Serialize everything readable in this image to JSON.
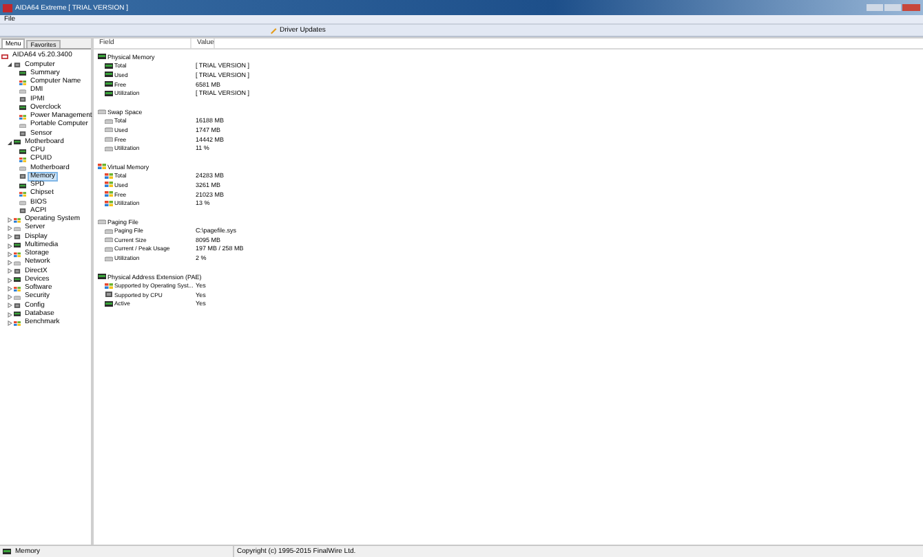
{
  "window": {
    "title": "AIDA64 Extreme [ TRIAL VERSION ]"
  },
  "menu": [
    "File"
  ],
  "toolbar": [
    {
      "label": "Driver Updates"
    }
  ],
  "tabs": [
    {
      "label": "Menu",
      "selected": true
    },
    {
      "label": "Favorites",
      "selected": false
    }
  ],
  "tree": {
    "label": "AIDA64 v5.20.3400",
    "children": [
      {
        "label": "Computer",
        "expanded": true,
        "selected": false,
        "children": [
          {
            "label": "Summary",
            "selected": false
          },
          {
            "label": "Computer Name",
            "selected": false
          },
          {
            "label": "DMI",
            "selected": false
          },
          {
            "label": "IPMI",
            "selected": false
          },
          {
            "label": "Overclock",
            "selected": false
          },
          {
            "label": "Power Management",
            "selected": false
          },
          {
            "label": "Portable Computer",
            "selected": false
          },
          {
            "label": "Sensor",
            "selected": false
          }
        ]
      },
      {
        "label": "Motherboard",
        "expanded": true,
        "selected": false,
        "children": [
          {
            "label": "CPU",
            "selected": false
          },
          {
            "label": "CPUID",
            "selected": false
          },
          {
            "label": "Motherboard",
            "selected": false
          },
          {
            "label": "Memory",
            "selected": true
          },
          {
            "label": "SPD",
            "selected": false
          },
          {
            "label": "Chipset",
            "selected": false
          },
          {
            "label": "BIOS",
            "selected": false
          },
          {
            "label": "ACPI",
            "selected": false
          }
        ]
      },
      {
        "label": "Operating System",
        "expanded": false,
        "selected": false
      },
      {
        "label": "Server",
        "expanded": false,
        "selected": false
      },
      {
        "label": "Display",
        "expanded": false,
        "selected": false
      },
      {
        "label": "Multimedia",
        "expanded": false,
        "selected": false
      },
      {
        "label": "Storage",
        "expanded": false,
        "selected": false
      },
      {
        "label": "Network",
        "expanded": false,
        "selected": false
      },
      {
        "label": "DirectX",
        "expanded": false,
        "selected": false
      },
      {
        "label": "Devices",
        "expanded": false,
        "selected": false
      },
      {
        "label": "Software",
        "expanded": false,
        "selected": false
      },
      {
        "label": "Security",
        "expanded": false,
        "selected": false
      },
      {
        "label": "Config",
        "expanded": false,
        "selected": false
      },
      {
        "label": "Database",
        "expanded": false,
        "selected": false
      },
      {
        "label": "Benchmark",
        "expanded": false,
        "selected": false
      }
    ]
  },
  "table": {
    "columns": [
      "Field",
      "Value"
    ],
    "groups": [
      {
        "title": "Physical Memory",
        "rows": [
          [
            "Total",
            "[ TRIAL VERSION ]"
          ],
          [
            "Used",
            "[ TRIAL VERSION ]"
          ],
          [
            "Free",
            "6581 MB"
          ],
          [
            "Utilization",
            "[ TRIAL VERSION ]"
          ]
        ]
      },
      {
        "title": "Swap Space",
        "rows": [
          [
            "Total",
            "16188 MB"
          ],
          [
            "Used",
            "1747 MB"
          ],
          [
            "Free",
            "14442 MB"
          ],
          [
            "Utilization",
            "11 %"
          ]
        ]
      },
      {
        "title": "Virtual Memory",
        "rows": [
          [
            "Total",
            "24283 MB"
          ],
          [
            "Used",
            "3261 MB"
          ],
          [
            "Free",
            "21023 MB"
          ],
          [
            "Utilization",
            "13 %"
          ]
        ]
      },
      {
        "title": "Paging File",
        "rows": [
          [
            "Paging File",
            "C:\\pagefile.sys"
          ],
          [
            "Current Size",
            "8095 MB"
          ],
          [
            "Current / Peak Usage",
            "197 MB / 258 MB"
          ],
          [
            "Utilization",
            "2 %"
          ]
        ]
      },
      {
        "title": "Physical Address Extension (PAE)",
        "rows": [
          [
            "Supported by Operating Syst...",
            "Yes"
          ],
          [
            "Supported by CPU",
            "Yes"
          ],
          [
            "Active",
            "Yes"
          ]
        ]
      }
    ]
  },
  "status_bar": {
    "left": "Memory",
    "center": "Copyright (c) 1995-2015 FinalWire Ltd."
  }
}
